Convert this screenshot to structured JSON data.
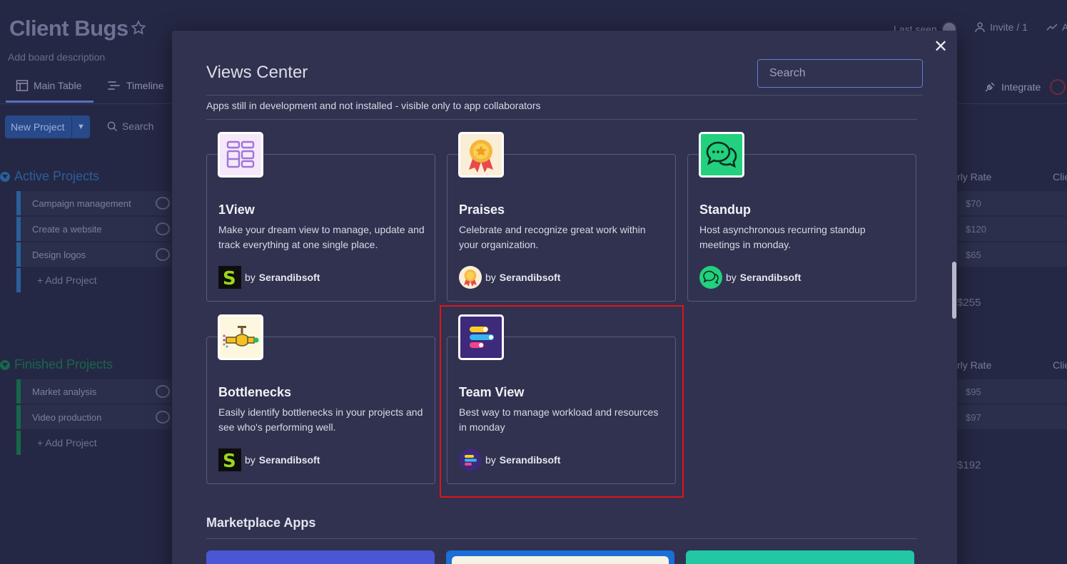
{
  "board": {
    "title": "Client Bugs",
    "description": "Add board description",
    "tabs": [
      {
        "label": "Main Table"
      },
      {
        "label": "Timeline"
      },
      {
        "label": "Integrate"
      }
    ],
    "topbar": {
      "last_seen": "Last seen",
      "invite": "Invite / 1",
      "activity": "A"
    },
    "new_project": "New Project",
    "search": "Search",
    "groups": [
      {
        "title": "Active Projects",
        "color": "#1f76c2",
        "rows": [
          "Campaign management",
          "Create a website",
          "Design logos"
        ],
        "add": "+ Add Project",
        "rates": [
          "$70",
          "$120",
          "$65"
        ],
        "sum": "$255",
        "col_header": "rly Rate",
        "col2_header": "Clie"
      },
      {
        "title": "Finished Projects",
        "color": "#037f4c",
        "rows": [
          "Market analysis",
          "Video production"
        ],
        "add": "+ Add Project",
        "rates": [
          "$95",
          "$97"
        ],
        "sum": "$192",
        "col_header": "rly Rate",
        "col2_header": "Clie"
      }
    ]
  },
  "modal": {
    "title": "Views Center",
    "search_placeholder": "Search",
    "dev_note": "Apps still in development and not installed - visible only to app collaborators",
    "apps": [
      {
        "name": "1View",
        "desc": "Make your dream view to manage, update and track everything at one single place.",
        "by": "by",
        "vendor": "Serandibsoft",
        "icon": "grid-icon"
      },
      {
        "name": "Praises",
        "desc": "Celebrate and recognize great work within your organization.",
        "by": "by",
        "vendor": "Serandibsoft",
        "icon": "medal-icon"
      },
      {
        "name": "Standup",
        "desc": "Host asynchronous recurring standup meetings in monday.",
        "by": "by",
        "vendor": "Serandibsoft",
        "icon": "chat-bubbles-icon"
      },
      {
        "name": "Bottlenecks",
        "desc": "Easily identify bottlenecks in your projects and see who's performing well.",
        "by": "by",
        "vendor": "Serandibsoft",
        "icon": "faucet-icon"
      },
      {
        "name": "Team View",
        "desc": "Best way to manage workload and resources in monday",
        "by": "by",
        "vendor": "Serandibsoft",
        "icon": "team-bars-icon"
      }
    ],
    "marketplace_title": "Marketplace Apps"
  },
  "colors": {
    "highlight": "#e0141a",
    "accent": "#5f7fd6"
  }
}
